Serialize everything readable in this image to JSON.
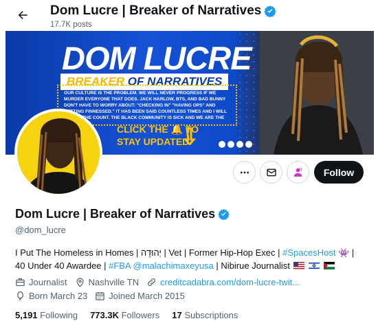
{
  "header": {
    "title": "Dom Lucre | Breaker of Narratives",
    "post_count": "17.7K posts"
  },
  "banner": {
    "title": "DOM LUCRE",
    "subtitle_part1": "BREAKER",
    "subtitle_part2": " OF NARRATIVES",
    "quote": "OUR CULTURE IS THE PROBLEM. WE WILL NEVER PROGRESS IF WE MURDER EVERYONE THAT DOES. JACK HARLOW, BTS, AND BAD BUNNY DON'T HAVE TO WORRY ABOUT: \"CHECKING IN\" \"HAVING OPS\" AND GETTING FINNESSED.\" IT HAS BEEN SAID COUNTLESS TIMES AND I WILL ADD TO THE COUNT. THE BLACK COMMUNITY IS SICK AND WE ARE THE SOLUTION.\"",
    "cta_line1": "CLICK THE 🔔 TO",
    "cta_line2": "STAY UPDATED"
  },
  "actions": {
    "follow_label": "Follow"
  },
  "profile": {
    "name": "Dom Lucre | Breaker of Narratives",
    "handle": "@dom_lucre",
    "bio_line1_a": "I Put The Homeless in Homes | יְהוּדָה | Vet | Former Hip-Hop Exec | ",
    "bio_line1_link": "#SpacesHost",
    "bio_line1_b": " 👾 |",
    "bio_line2_a": "40 Under 40 Awardee | ",
    "bio_line2_link1": "#FBA",
    "bio_line2_space": " ",
    "bio_line2_link2": "@malachimaxeyusa",
    "bio_line2_b": " | Nibirue Journalist",
    "job": "Journalist",
    "location": "Nashville TN",
    "website": "creditcadabra.com/dom-lucre-twit...",
    "born": "Born March 23",
    "joined": "Joined March 2015"
  },
  "stats": {
    "following_count": "5,191",
    "following_label": " Following",
    "followers_count": "773.3K",
    "followers_label": " Followers",
    "subscriptions_count": "17",
    "subscriptions_label": " Subscriptions"
  },
  "colors": {
    "accent": "#1d9bf0",
    "banner_blue": "#1552d6",
    "banner_yellow": "#f5c400",
    "subscribe_purple": "#c936cc"
  },
  "icons": [
    "back-arrow-icon",
    "verified-badge-icon",
    "more-icon",
    "message-icon",
    "subscribe-icon",
    "briefcase-icon",
    "location-icon",
    "link-icon",
    "balloon-icon",
    "calendar-icon"
  ]
}
